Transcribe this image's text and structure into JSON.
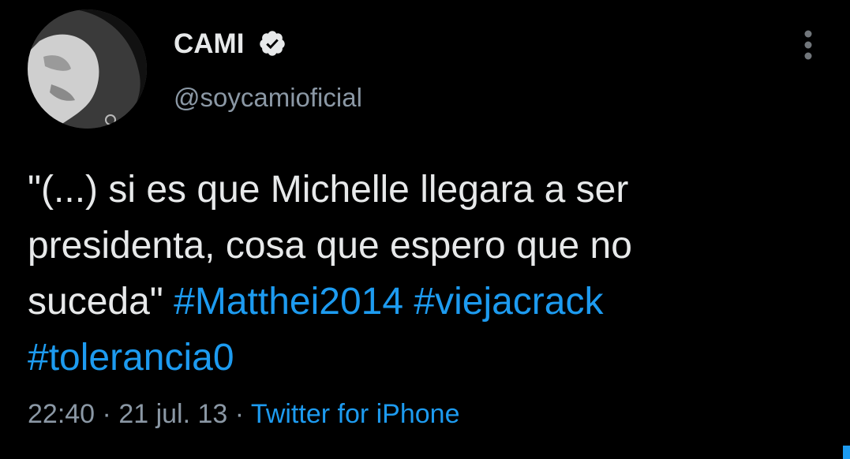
{
  "author": {
    "display_name": "CAMI",
    "handle": "@soycamioficial",
    "verified": true
  },
  "tweet": {
    "line1": "\"(...) si es que Michelle llegara a ser",
    "line2": "presidenta, cosa que espero que no",
    "line3_text": "suceda\" ",
    "hashtags": [
      "#Matthei2014",
      "#viejacrack",
      "#tolerancia0"
    ]
  },
  "meta": {
    "time": "22:40",
    "sep1": " · ",
    "date": "21 jul. 13",
    "sep2": " · ",
    "source": "Twitter for iPhone"
  },
  "icons": {
    "verified": "verified-badge-icon",
    "more": "more-vertical-icon"
  },
  "colors": {
    "background": "#000000",
    "text": "#e7e9ea",
    "secondary": "#8b98a5",
    "accent": "#1d9bf0"
  }
}
